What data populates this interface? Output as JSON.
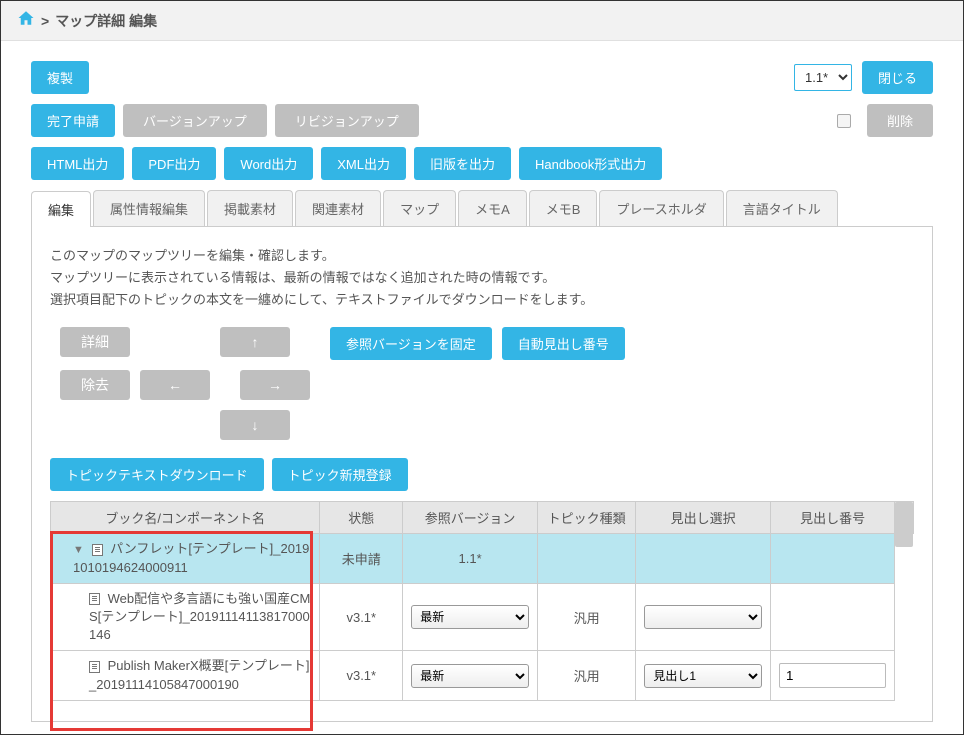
{
  "breadcrumb": {
    "separator": ">",
    "title": "マップ詳細 編集"
  },
  "toolbar": {
    "duplicate": "複製",
    "close": "閉じる",
    "version_value": "1.1*",
    "complete_request": "完了申請",
    "version_up": "バージョンアップ",
    "revision_up": "リビジョンアップ",
    "delete": "削除",
    "html_out": "HTML出力",
    "pdf_out": "PDF出力",
    "word_out": "Word出力",
    "xml_out": "XML出力",
    "oldver_out": "旧版を出力",
    "handbook_out": "Handbook形式出力"
  },
  "tabs": [
    {
      "label": "編集"
    },
    {
      "label": "属性情報編集"
    },
    {
      "label": "掲載素材"
    },
    {
      "label": "関連素材"
    },
    {
      "label": "マップ"
    },
    {
      "label": "メモA"
    },
    {
      "label": "メモB"
    },
    {
      "label": "プレースホルダ"
    },
    {
      "label": "言語タイトル"
    }
  ],
  "panel": {
    "desc1": "このマップのマップツリーを編集・確認します。",
    "desc2": "マップツリーに表示されている情報は、最新の情報ではなく追加された時の情報です。",
    "desc3": "選択項目配下のトピックの本文を一纏めにして、テキストファイルでダウンロードをします。",
    "btn_detail": "詳細",
    "btn_up": "↑",
    "btn_fix_ref": "参照バージョンを固定",
    "btn_auto_heading": "自動見出し番号",
    "btn_remove": "除去",
    "btn_left": "←",
    "btn_right": "→",
    "btn_down": "↓",
    "btn_topic_dl": "トピックテキストダウンロード",
    "btn_topic_new": "トピック新規登録"
  },
  "table": {
    "headers": {
      "name": "ブック名/コンポーネント名",
      "status": "状態",
      "ref_version": "参照バージョン",
      "topic_type": "トピック種類",
      "heading_sel": "見出し選択",
      "heading_num": "見出し番号"
    },
    "rows": [
      {
        "name": "パンフレット[テンプレート]_20191010194624000911",
        "status": "未申請",
        "ref_version": "1.1*",
        "topic_type": "",
        "heading_sel": "",
        "heading_num": ""
      },
      {
        "name": "Web配信や多言語にも強い国産CMS[テンプレート]_20191114113817000146",
        "status": "v3.1*",
        "ref_version": "最新",
        "topic_type": "汎用",
        "heading_sel": "",
        "heading_num": ""
      },
      {
        "name": "Publish MakerX概要[テンプレート]_20191114105847000190",
        "status": "v3.1*",
        "ref_version": "最新",
        "topic_type": "汎用",
        "heading_sel": "見出し1",
        "heading_num": "1"
      }
    ]
  }
}
